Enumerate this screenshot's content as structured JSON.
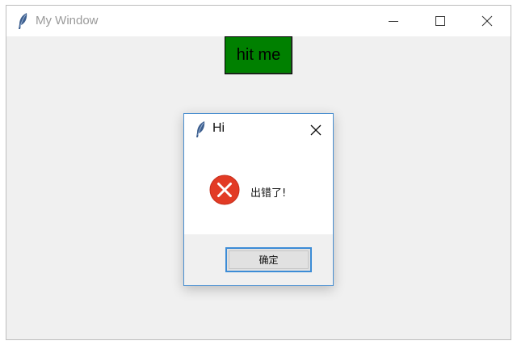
{
  "main_window": {
    "title": "My Window",
    "title_icon": "feather-icon",
    "controls": [
      "minimize-icon",
      "maximize-icon",
      "close-icon"
    ]
  },
  "main_content": {
    "hit_button_label": "hit me",
    "hit_button_color": "#008000"
  },
  "dialog": {
    "title": "Hi",
    "title_icon": "feather-icon",
    "icon": "error-icon",
    "icon_color": "#e23b25",
    "message": "出错了!",
    "ok_label": "确定",
    "focus_color": "#3c8cd6"
  }
}
